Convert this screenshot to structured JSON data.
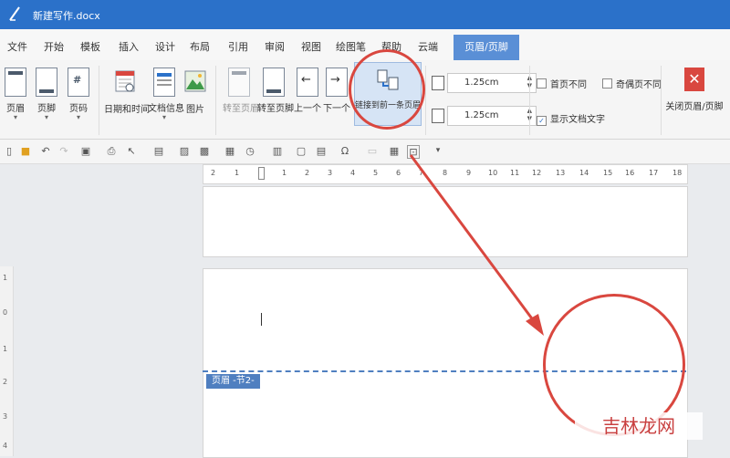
{
  "window": {
    "title": "新建写作.docx"
  },
  "menu": {
    "items": [
      "文件",
      "开始",
      "模板",
      "插入",
      "设计",
      "布局",
      "引用",
      "审阅",
      "视图",
      "绘图笔",
      "帮助",
      "云端"
    ],
    "active_tab": "页眉/页脚"
  },
  "ribbon": {
    "header_btn": "页眉",
    "footer_btn": "页脚",
    "pagenum_btn": "页码",
    "datetime_btn": "日期和时间",
    "docinfo_btn": "文档信息",
    "picture_btn": "图片",
    "goto_header_btn": "转至页眉",
    "goto_footer_btn": "转至页脚",
    "prev_btn": "上一个",
    "next_btn": "下一个",
    "link_prev_btn": "链接到前一条页眉",
    "header_top": "1.25cm",
    "footer_bottom": "1.25cm",
    "diff_first_page": "首页不同",
    "diff_odd_even": "奇偶页不同",
    "show_doc_text": "显示文档文字",
    "close_btn": "关闭页眉/页脚"
  },
  "ruler": {
    "ticks": [
      "2",
      "1",
      "",
      "1",
      "2",
      "3",
      "4",
      "5",
      "6",
      "7",
      "8",
      "9",
      "10",
      "11",
      "12",
      "13",
      "14",
      "15",
      "16",
      "17",
      "18"
    ]
  },
  "vruler": {
    "ticks": [
      "1",
      "0",
      "1",
      "2",
      "3",
      "4"
    ]
  },
  "document": {
    "header_tag": "页眉 -节2-"
  },
  "watermark": {
    "text": "吉林龙网"
  },
  "colors": {
    "accent": "#2b71c9",
    "annotation": "#d9473f",
    "header_line": "#4f7fc0"
  }
}
